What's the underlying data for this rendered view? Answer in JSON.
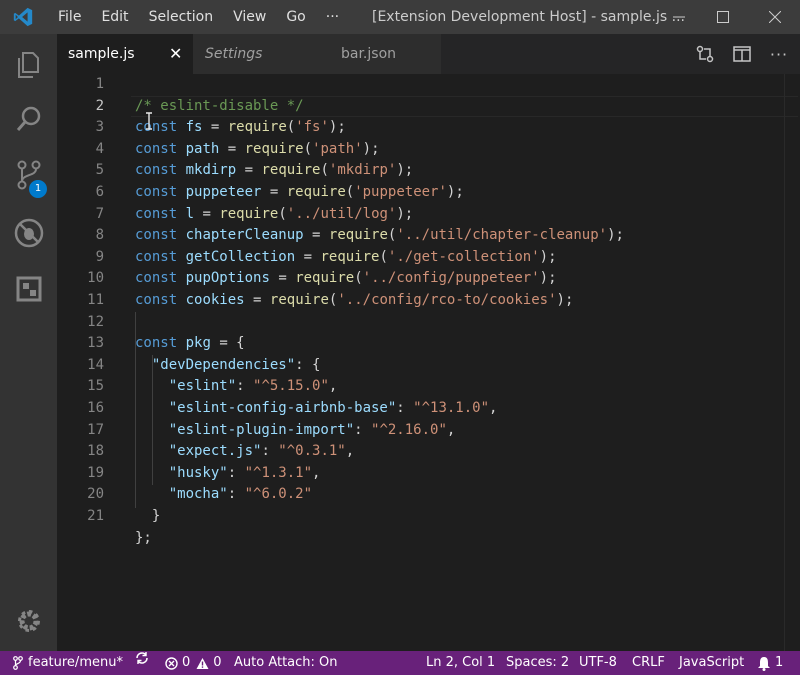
{
  "titlebar": {
    "menu": [
      "File",
      "Edit",
      "Selection",
      "View",
      "Go",
      "···"
    ],
    "window_title": "[Extension Development Host] - sample.js ...",
    "accent": "#3c3c3c"
  },
  "activitybar": {
    "items": [
      "explorer-icon",
      "search-icon",
      "source-control-icon",
      "debug-icon",
      "extensions-icon"
    ],
    "scm_badge": "1",
    "manage_icon": "gear-icon"
  },
  "tabs": [
    {
      "label": "sample.js",
      "active": true
    },
    {
      "label": "Settings",
      "active": false
    },
    {
      "label": "bar.json",
      "active": false
    }
  ],
  "editor": {
    "current_line": 2,
    "lines": [
      {
        "n": "1"
      },
      {
        "n": "2"
      },
      {
        "n": "3"
      },
      {
        "n": "4"
      },
      {
        "n": "5"
      },
      {
        "n": "6"
      },
      {
        "n": "7"
      },
      {
        "n": "8"
      },
      {
        "n": "9"
      },
      {
        "n": "10"
      },
      {
        "n": "11"
      },
      {
        "n": "12"
      },
      {
        "n": "13"
      },
      {
        "n": "14"
      },
      {
        "n": "15"
      },
      {
        "n": "16"
      },
      {
        "n": "17"
      },
      {
        "n": "18"
      },
      {
        "n": "19"
      },
      {
        "n": "20"
      },
      {
        "n": "21"
      }
    ],
    "tokens": {
      "l1": "/* eslint-disable */",
      "const": "const",
      "require": "require",
      "l2v": "fs",
      "l2s": "'fs'",
      "l3v": "path",
      "l3s": "'path'",
      "l4v": "mkdirp",
      "l4s": "'mkdirp'",
      "l5v": "puppeteer",
      "l5s": "'puppeteer'",
      "l6v": "l",
      "l6s": "'../util/log'",
      "l7v": "chapterCleanup",
      "l7s": "'../util/chapter-cleanup'",
      "l8v": "getCollection",
      "l8s": "'./get-collection'",
      "l9v": "pupOptions",
      "l9s": "'../config/puppeteer'",
      "l10v": "cookies",
      "l10s": "'../config/rco-to/cookies'",
      "l12v": "pkg",
      "l13k": "\"devDependencies\"",
      "deps": [
        {
          "k": "\"eslint\"",
          "v": "\"^5.15.0\""
        },
        {
          "k": "\"eslint-config-airbnb-base\"",
          "v": "\"^13.1.0\""
        },
        {
          "k": "\"eslint-plugin-import\"",
          "v": "\"^2.16.0\""
        },
        {
          "k": "\"expect.js\"",
          "v": "\"^0.3.1\""
        },
        {
          "k": "\"husky\"",
          "v": "\"^1.3.1\""
        },
        {
          "k": "\"mocha\"",
          "v": "\"^6.0.2\""
        }
      ]
    }
  },
  "statusbar": {
    "branch": "feature/menu*",
    "errors": "0",
    "warnings": "0",
    "auto_attach": "Auto Attach: On",
    "position": "Ln 2, Col 1",
    "spaces": "Spaces: 2",
    "encoding": "UTF-8",
    "eol": "CRLF",
    "language": "JavaScript",
    "notifications": "1",
    "color": "#68217a"
  }
}
